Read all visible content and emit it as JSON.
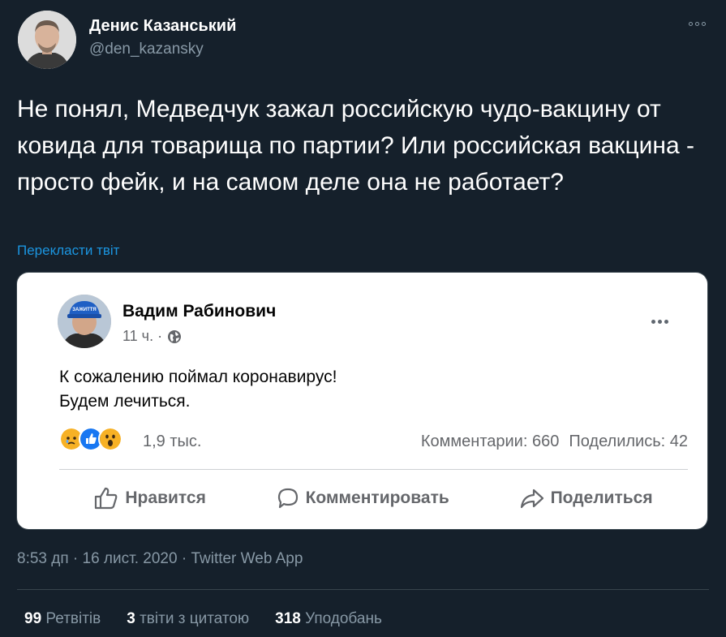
{
  "tweet": {
    "author_name": "Денис Казанський",
    "author_handle": "@den_kazansky",
    "text": "Не понял, Медведчук зажал российскую чудо-вакцину от ковида для товарища по партии? Или российская вакцина - просто фейк, и на самом деле она не работает?",
    "translate_label": "Перекласти твіт",
    "timestamp": "8:53 дп · 16 лист. 2020 · ",
    "source_app": "Twitter Web App",
    "stats": {
      "retweets_count": "99",
      "retweets_label": "Ретвітів",
      "quotes_count": "3",
      "quotes_label": "твіти з цитатою",
      "likes_count": "318",
      "likes_label": "Уподобань"
    }
  },
  "embedded_post": {
    "author_name": "Вадим Рабинович",
    "cap_text": "ЗАЖИТТЯ",
    "time": "11 ч. ·",
    "text": "К сожалению поймал коронавирус!\nБудем лечиться.",
    "reactions_count": "1,9 тыс.",
    "comments": "Комментарии: 660",
    "shares": "Поделились: 42",
    "actions": {
      "like": "Нравится",
      "comment": "Комментировать",
      "share": "Поделиться"
    }
  },
  "colors": {
    "background": "#15202b",
    "link": "#1b95e0",
    "muted": "#8899a6",
    "fb_gray": "#65676b"
  }
}
